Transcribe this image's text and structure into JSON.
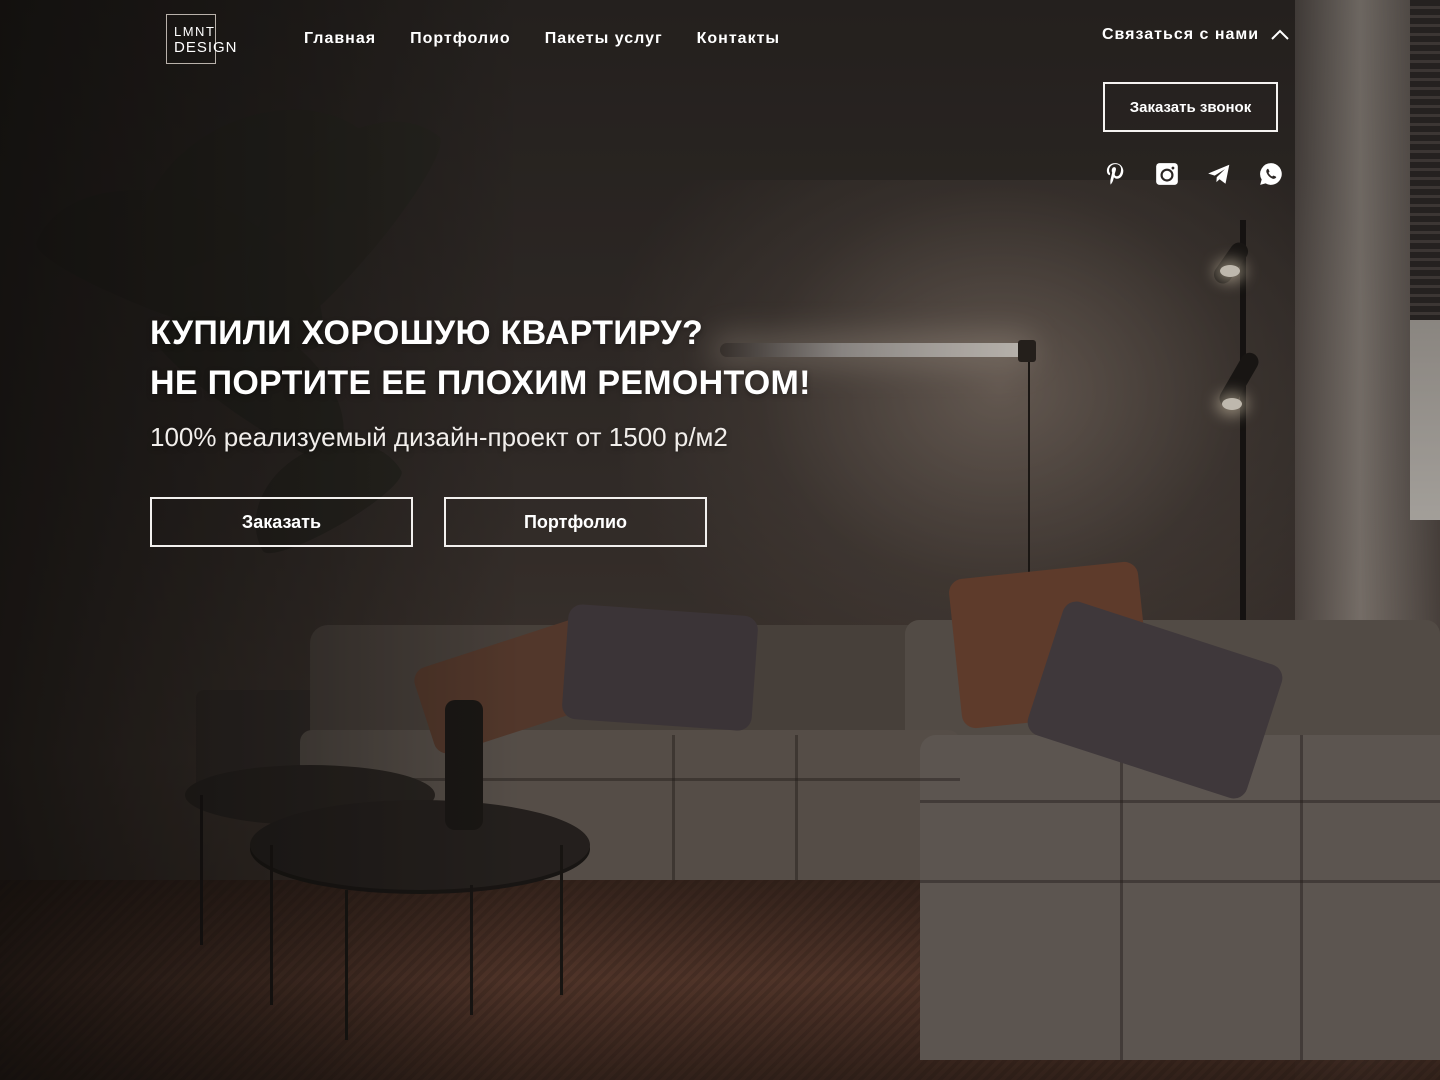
{
  "logo": {
    "line1": "LMNT",
    "line2": "DESIGN"
  },
  "nav": {
    "items": [
      {
        "label": "Главная"
      },
      {
        "label": "Портфолио"
      },
      {
        "label": "Пакеты услуг"
      },
      {
        "label": "Контакты"
      }
    ]
  },
  "contact": {
    "toggle_label": "Связаться с нами",
    "toggle_icon": "chevron-up-icon",
    "call_button": "Заказать звонок",
    "socials": [
      {
        "name": "pinterest-icon"
      },
      {
        "name": "instagram-icon"
      },
      {
        "name": "telegram-icon"
      },
      {
        "name": "whatsapp-icon"
      }
    ]
  },
  "hero": {
    "headline_line1": "КУПИЛИ ХОРОШУЮ КВАРТИРУ?",
    "headline_line2": "НЕ ПОРТИТЕ ЕЕ ПЛОХИМ РЕМОНТОМ!",
    "subheadline": "100% реализуемый дизайн-проект от 1500 р/м2",
    "primary_button": "Заказать",
    "secondary_button": "Портфолио"
  },
  "colors": {
    "text": "#ffffff",
    "button_border": "#f2f0ee",
    "background": "#2f2a27"
  }
}
